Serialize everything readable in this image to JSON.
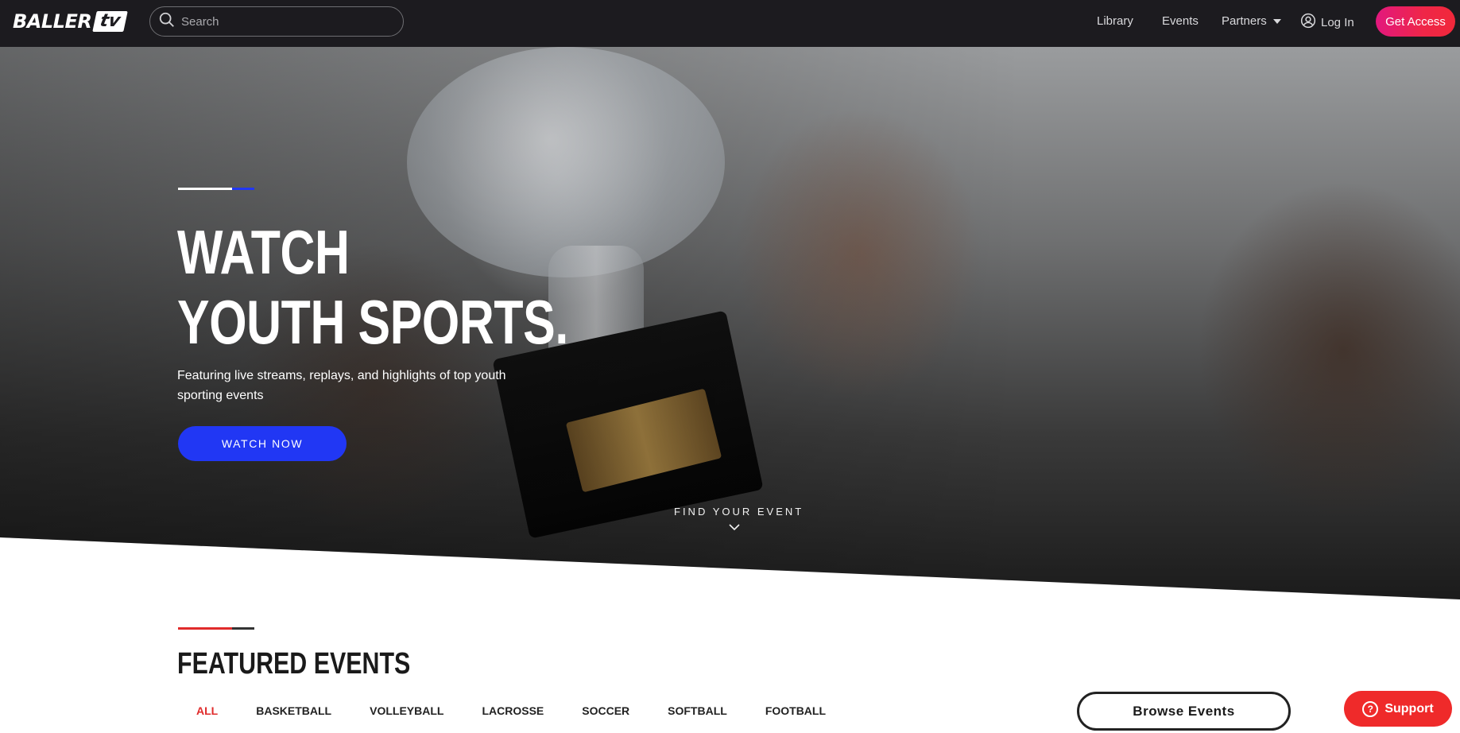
{
  "header": {
    "logo_word": "BALLER",
    "logo_box": "tv",
    "search_placeholder": "Search",
    "nav": {
      "library": "Library",
      "events": "Events",
      "partners": "Partners",
      "login": "Log In"
    },
    "cta_label": "Get Access"
  },
  "hero": {
    "title_line1": "WATCH",
    "title_line2": "YOUTH SPORTS.",
    "subtitle": "Featuring live streams, replays, and highlights of top youth sporting events",
    "cta_label": "WATCH NOW",
    "find_event_label": "FIND YOUR EVENT"
  },
  "featured": {
    "title": "FEATURED EVENTS",
    "filters": [
      "ALL",
      "BASKETBALL",
      "VOLLEYBALL",
      "LACROSSE",
      "SOCCER",
      "SOFTBALL",
      "FOOTBALL"
    ],
    "active_filter": "ALL",
    "browse_label": "Browse Events"
  },
  "support": {
    "label": "Support"
  },
  "colors": {
    "nav_bg": "#1c1b1f",
    "accent_blue": "#2137f4",
    "accent_red": "#e02b2b",
    "cta_gradient_start": "#e2187e",
    "cta_gradient_end": "#f0283a",
    "support_red": "#ef2a2a"
  },
  "icons": {
    "search": "search-icon",
    "user": "user-circle-icon",
    "partners_caret": "caret-down-icon",
    "find_event": "chevron-down-icon",
    "support": "question-icon"
  }
}
